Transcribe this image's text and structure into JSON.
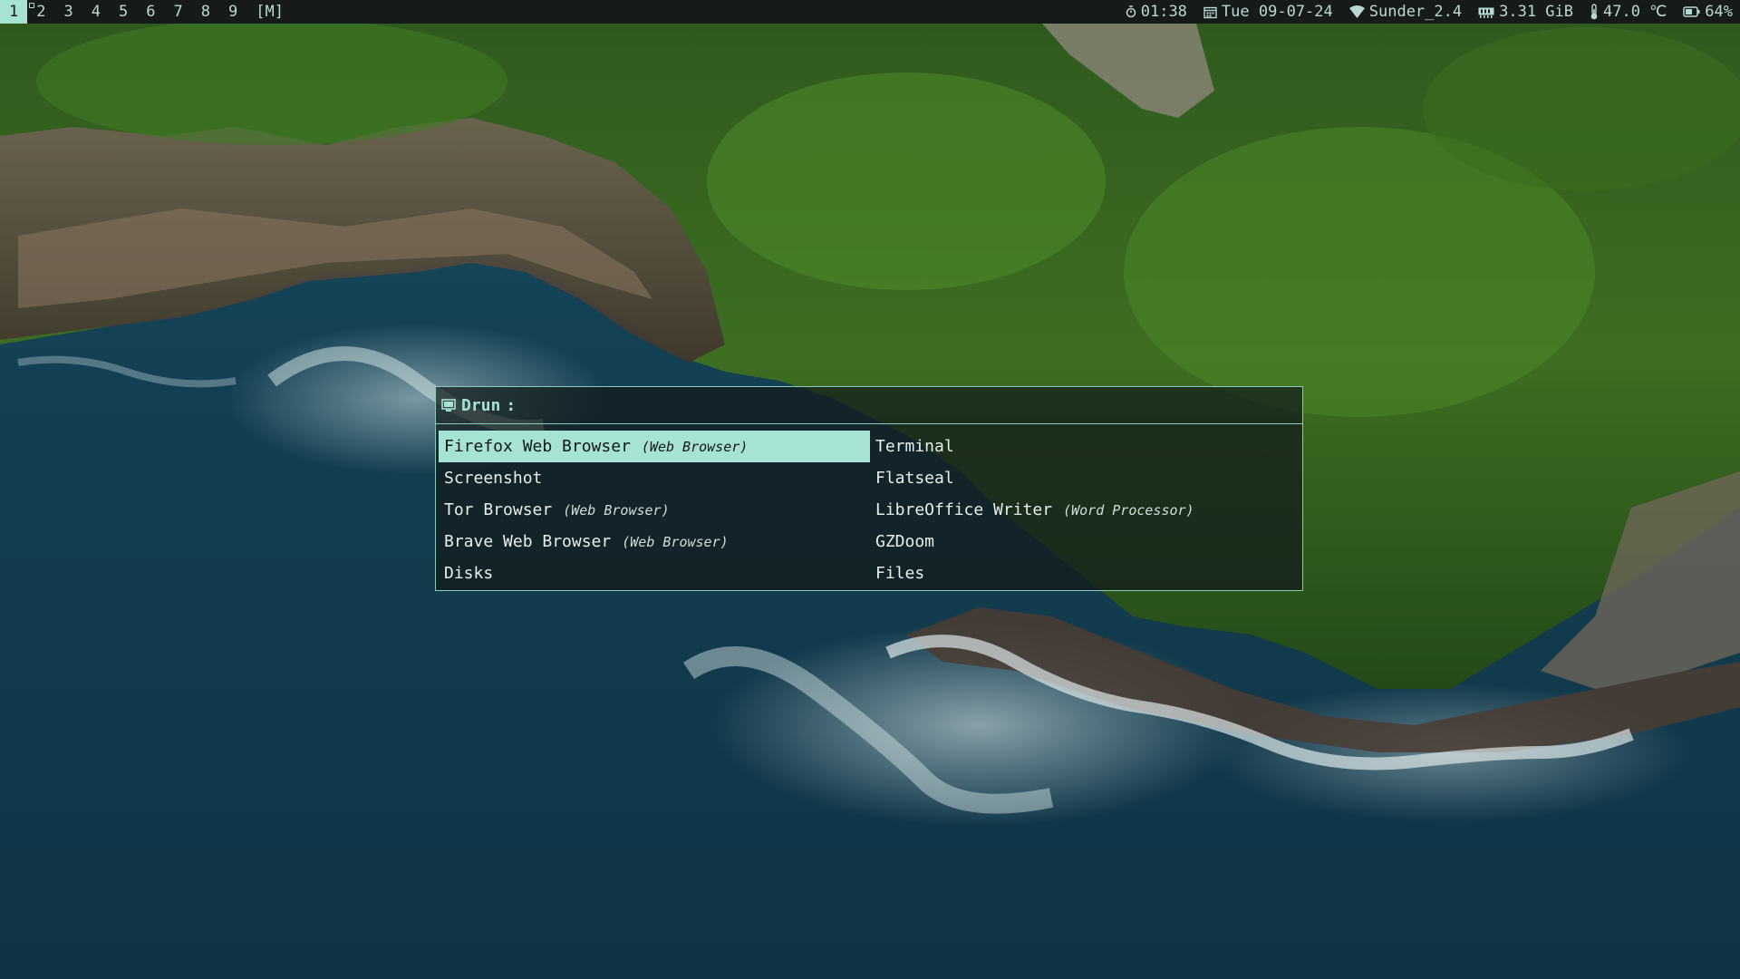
{
  "workspaces": {
    "items": [
      "1",
      "2",
      "3",
      "4",
      "5",
      "6",
      "7",
      "8",
      "9"
    ],
    "active": "1",
    "layout": "[M]"
  },
  "status": {
    "time": "01:38",
    "date": "Tue 09-07-24",
    "wifi": "Sunder_2.4",
    "memory": "3.31 GiB",
    "temperature": "47.0 ℃",
    "battery": "64%"
  },
  "launcher": {
    "mode": "Drun",
    "separator": ":",
    "entries": [
      {
        "name": "Firefox Web Browser",
        "generic": "(Web Browser)",
        "selected": true
      },
      {
        "name": "Screenshot",
        "generic": ""
      },
      {
        "name": "Tor Browser",
        "generic": "(Web Browser)"
      },
      {
        "name": "Brave Web Browser",
        "generic": "(Web Browser)"
      },
      {
        "name": "Disks",
        "generic": ""
      },
      {
        "name": "Terminal",
        "generic": ""
      },
      {
        "name": "Flatseal",
        "generic": ""
      },
      {
        "name": "LibreOffice Writer",
        "generic": "(Word Processor)"
      },
      {
        "name": "GZDoom",
        "generic": ""
      },
      {
        "name": "Files",
        "generic": ""
      }
    ]
  },
  "colors": {
    "accent": "#a7e3d5",
    "bar_bg": "#161a1a",
    "text": "#b8d8d2"
  }
}
